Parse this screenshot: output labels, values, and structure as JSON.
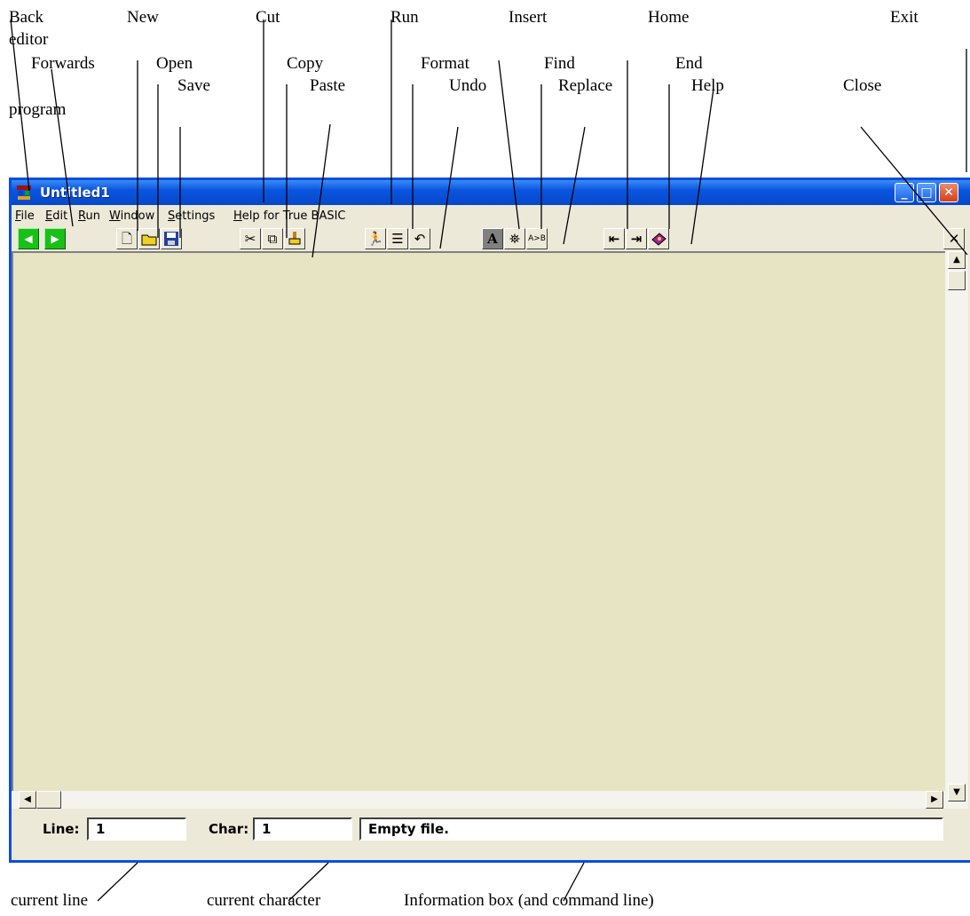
{
  "annotations": {
    "back": "Back",
    "editor": "editor",
    "new": "New",
    "cut": "Cut",
    "run": "Run",
    "insert": "Insert",
    "home": "Home",
    "exit": "Exit",
    "forwards": "Forwards",
    "open": "Open",
    "copy": "Copy",
    "format": "Format",
    "find": "Find",
    "end": "End",
    "save": "Save",
    "paste": "Paste",
    "undo": "Undo",
    "replace": "Replace",
    "help": "Help",
    "close": "Close",
    "program": "program",
    "current_line": "current line",
    "current_character": "current character",
    "information_box": "Information box (and command line)"
  },
  "window": {
    "title": "Untitled1"
  },
  "menu": [
    "File",
    "Edit",
    "Run",
    "Window",
    "Settings",
    "Help for True BASIC"
  ],
  "toolbar": {
    "icons": [
      "back-icon",
      "forward-icon",
      "new-icon",
      "open-icon",
      "save-icon",
      "cut-icon",
      "copy-icon",
      "paste-icon",
      "run-icon",
      "format-icon",
      "undo-icon",
      "insert-icon",
      "find-icon",
      "replace-icon",
      "home-icon",
      "end-icon",
      "help-icon",
      "close-icon"
    ],
    "replace_glyph": "A>B"
  },
  "status": {
    "line_label": "Line:",
    "line_value": "1",
    "char_label": "Char:",
    "char_value": "1",
    "info": "Empty file."
  },
  "colors": {
    "titlebar": "#0a55e0",
    "editor_bg": "#e6e4c3",
    "green_button": "#18c018"
  }
}
